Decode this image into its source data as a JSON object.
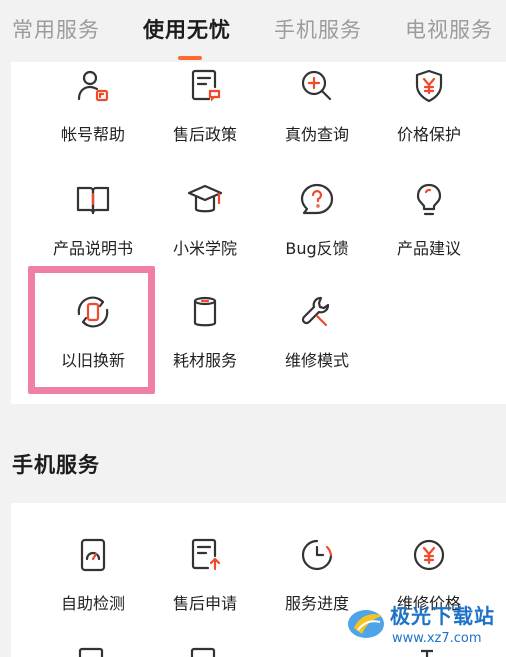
{
  "tabs": [
    {
      "label": "常用服务",
      "active": false
    },
    {
      "label": "使用无忧",
      "active": true
    },
    {
      "label": "手机服务",
      "active": false
    },
    {
      "label": "电视服务",
      "active": false
    }
  ],
  "worry_free": {
    "items": [
      {
        "label": "帐号帮助",
        "icon": "account-help-icon"
      },
      {
        "label": "售后政策",
        "icon": "after-sales-policy-icon"
      },
      {
        "label": "真伪查询",
        "icon": "authenticity-check-icon"
      },
      {
        "label": "价格保护",
        "icon": "price-protection-icon"
      },
      {
        "label": "产品说明书",
        "icon": "product-manual-icon"
      },
      {
        "label": "小米学院",
        "icon": "xiaomi-academy-icon"
      },
      {
        "label": "Bug反馈",
        "icon": "bug-feedback-icon"
      },
      {
        "label": "产品建议",
        "icon": "product-suggestion-icon"
      },
      {
        "label": "以旧换新",
        "icon": "trade-in-icon"
      },
      {
        "label": "耗材服务",
        "icon": "consumables-icon"
      },
      {
        "label": "维修模式",
        "icon": "repair-mode-icon"
      }
    ]
  },
  "phone_service": {
    "title": "手机服务",
    "items": [
      {
        "label": "自助检测",
        "icon": "self-check-icon"
      },
      {
        "label": "售后申请",
        "icon": "after-sales-apply-icon"
      },
      {
        "label": "服务进度",
        "icon": "service-progress-icon"
      },
      {
        "label": "维修价格",
        "icon": "repair-price-icon"
      }
    ]
  },
  "watermark": {
    "title": "极光下载站",
    "url": "www.xz7.com"
  },
  "colors": {
    "accent": "#ff6a33",
    "highlight": "#f07fa8",
    "icon_stroke": "#333333",
    "icon_accent": "#f04a2a"
  }
}
